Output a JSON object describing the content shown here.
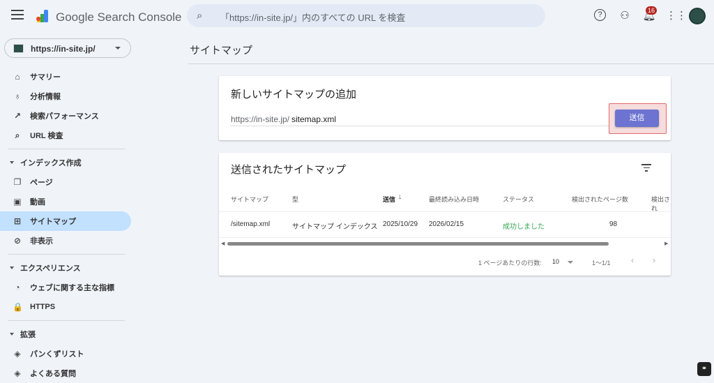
{
  "header": {
    "brand": "Google Search Console",
    "search_placeholder": "「https://in-site.jp/」内のすべての URL を検査",
    "notifications": "16"
  },
  "property": {
    "url": "https://in-site.jp/"
  },
  "sidebar": {
    "items": [
      {
        "label": "サマリー",
        "icon": "⌂"
      },
      {
        "label": "分析情報",
        "icon": "♁"
      },
      {
        "label": "検索パフォーマンス",
        "icon": "↗"
      },
      {
        "label": "URL 検査",
        "icon": "⌕"
      }
    ],
    "sections": [
      {
        "label": "インデックス作成",
        "items": [
          {
            "label": "ページ",
            "icon": "❐"
          },
          {
            "label": "動画",
            "icon": "▣"
          },
          {
            "label": "サイトマップ",
            "icon": "⊞",
            "selected": true
          },
          {
            "label": "非表示",
            "icon": "⊘"
          }
        ]
      },
      {
        "label": "エクスペリエンス",
        "items": [
          {
            "label": "ウェブに関する主な指標",
            "icon": "◔"
          },
          {
            "label": "HTTPS",
            "icon": "🔒"
          }
        ]
      },
      {
        "label": "拡張",
        "items": [
          {
            "label": "パンくずリスト",
            "icon": "◈"
          },
          {
            "label": "よくある質問",
            "icon": "◈"
          }
        ]
      }
    ]
  },
  "page": {
    "title": "サイトマップ"
  },
  "add": {
    "title": "新しいサイトマップの追加",
    "prefix": "https://in-site.jp/",
    "value": "sitemap.xml",
    "submit": "送信"
  },
  "submitted": {
    "title": "送信されたサイトマップ",
    "columns": [
      "サイトマップ",
      "型",
      "送信",
      "最終読み込み日時",
      "ステータス",
      "検出されたページ数",
      "検出され"
    ],
    "rows": [
      [
        "/sitemap.xml",
        "サイトマップ インデックス",
        "2025/10/29",
        "2026/02/15",
        "成功しました",
        "98"
      ]
    ],
    "rows_per_page_label": "1 ページあたりの行数:",
    "rows_per_page": "10",
    "range": "1〜1/1",
    "status_color": "#34a853"
  }
}
